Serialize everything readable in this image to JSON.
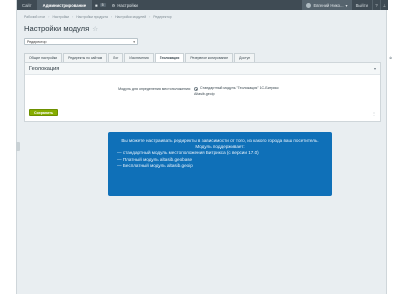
{
  "topbar": {
    "site": "Сайт",
    "admin": "Администрирование",
    "count": "5",
    "settings": "Настройки",
    "user": "Евгений Нико...",
    "logout": "Выйти"
  },
  "breadcrumb": [
    "Рабочий стол",
    "Настройки",
    "Настройки продукта",
    "Настройки модулей",
    "Редиректор"
  ],
  "page": {
    "title": "Настройки модуля",
    "star": "☆"
  },
  "module_select": {
    "value": "Редиректор"
  },
  "tabs": [
    {
      "label": "Общие настройки"
    },
    {
      "label": "Редиректы по сайтам"
    },
    {
      "label": "Лог"
    },
    {
      "label": "Исключения"
    },
    {
      "label": "Геолокация"
    },
    {
      "label": "Резервное копирование"
    },
    {
      "label": "Доступ"
    }
  ],
  "active_tab": "Геолокация",
  "panel": {
    "title": "Геолокация",
    "field_label": "Модуль для определения местоположения:",
    "options": [
      "Стандартный модуль \"Геолокация\" 1С-Битрикс",
      "Altasib.geoip"
    ],
    "selected_option": "Стандартный модуль \"Геолокация\" 1С-Битрикс",
    "save_label": "Сохранить"
  },
  "info": {
    "intro": "Вы можете настраивать редиректы в зависимости от того, из какого города ваш посетитель. Модуль поддерживает:",
    "items": [
      "— стандартный модуль местоположения Битрикса (с версии 17.0)",
      "— Платный модуль altasib.geobase",
      "— Бесплатный модуль altasib.geoip"
    ]
  },
  "colors": {
    "topbar": "#3f4b54",
    "info_bg": "#0f70b8",
    "save_btn": "#86ad00",
    "page_bg": "#e9eef1"
  }
}
